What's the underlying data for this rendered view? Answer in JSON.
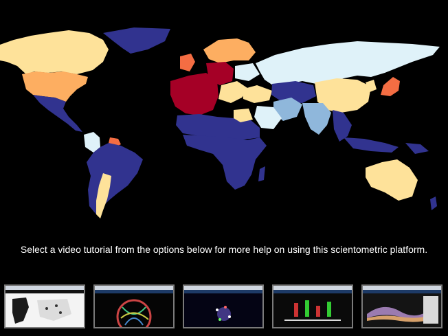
{
  "caption": "Select a video tutorial from the options below for more help on using this scientometric platform.",
  "palette": {
    "dark_blue": "#31338f",
    "light_blue": "#dff2f9",
    "mid_blue": "#8fb7db",
    "pale_yellow": "#fee29a",
    "orange": "#fdae61",
    "red_orange": "#f46d43",
    "dark_red": "#a50026"
  },
  "thumbnails": [
    {
      "label": "tutorial-map-view"
    },
    {
      "label": "tutorial-chord-diagram"
    },
    {
      "label": "tutorial-network-graph"
    },
    {
      "label": "tutorial-bar-distribution"
    },
    {
      "label": "tutorial-stream-graph"
    }
  ]
}
